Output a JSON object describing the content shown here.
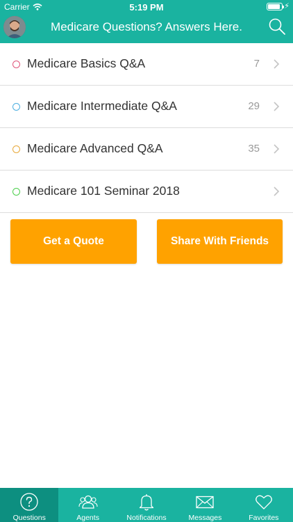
{
  "status_bar": {
    "carrier": "Carrier",
    "time": "5:19 PM",
    "battery_level": 0.9
  },
  "nav": {
    "title": "Medicare Questions? Answers Here.",
    "search_icon": "search-icon"
  },
  "colors": {
    "header": "#1ab3a0",
    "tab_active": "#0d8f80",
    "button": "#ffa200"
  },
  "list": [
    {
      "label": "Medicare Basics Q&A",
      "count": "7",
      "dot_color": "#e0547a"
    },
    {
      "label": "Medicare Intermediate Q&A",
      "count": "29",
      "dot_color": "#4aaee0"
    },
    {
      "label": "Medicare Advanced Q&A",
      "count": "35",
      "dot_color": "#e8a93a"
    },
    {
      "label": "Medicare 101 Seminar 2018",
      "count": "",
      "dot_color": "#4ccf4c"
    }
  ],
  "buttons": {
    "quote": "Get a Quote",
    "share": "Share With Friends"
  },
  "tabs": [
    {
      "label": "Questions",
      "icon": "question-circle-icon",
      "active": true
    },
    {
      "label": "Agents",
      "icon": "people-icon",
      "active": false
    },
    {
      "label": "Notifications",
      "icon": "bell-icon",
      "active": false
    },
    {
      "label": "Messages",
      "icon": "envelope-icon",
      "active": false
    },
    {
      "label": "Favorites",
      "icon": "heart-icon",
      "active": false
    }
  ]
}
